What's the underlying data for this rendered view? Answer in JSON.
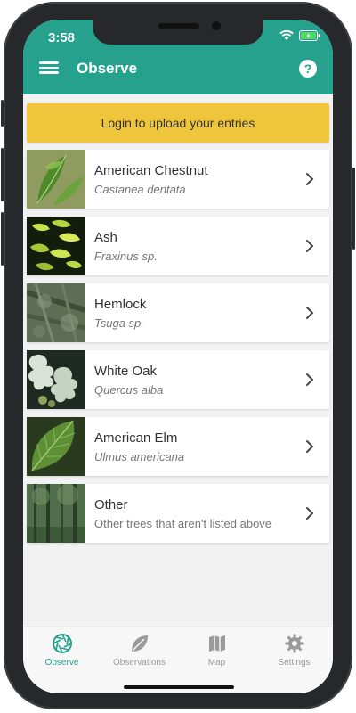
{
  "status_bar": {
    "time": "3:58"
  },
  "header": {
    "title": "Observe",
    "help_glyph": "?"
  },
  "banner": {
    "text": "Login to upload your entries",
    "color": "#efc63b"
  },
  "species": [
    {
      "name": "American Chestnut",
      "subtitle": "Castanea dentata",
      "icon": "chestnut-leaf-photo"
    },
    {
      "name": "Ash",
      "subtitle": "Fraxinus sp.",
      "icon": "ash-leaf-photo"
    },
    {
      "name": "Hemlock",
      "subtitle": "Tsuga sp.",
      "icon": "hemlock-photo"
    },
    {
      "name": "White Oak",
      "subtitle": "Quercus alba",
      "icon": "oak-leaf-photo"
    },
    {
      "name": "American Elm",
      "subtitle": "Ulmus americana",
      "icon": "elm-leaf-photo"
    },
    {
      "name": "Other",
      "subtitle": "Other trees that aren't listed above",
      "icon": "forest-photo"
    }
  ],
  "tabs": [
    {
      "label": "Observe",
      "icon": "aperture-icon",
      "active": true
    },
    {
      "label": "Observations",
      "icon": "leaf-icon",
      "active": false
    },
    {
      "label": "Map",
      "icon": "map-icon",
      "active": false
    },
    {
      "label": "Settings",
      "icon": "gear-icon",
      "active": false
    }
  ],
  "colors": {
    "accent": "#25a18e",
    "banner": "#efc63b",
    "inactive": "#999999"
  }
}
